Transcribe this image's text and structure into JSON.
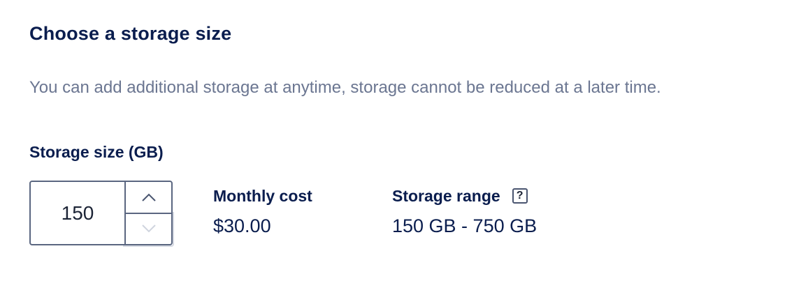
{
  "section": {
    "title": "Choose a storage size",
    "description": "You can add additional storage at anytime, storage cannot be reduced at a later time."
  },
  "storage_field": {
    "label": "Storage size (GB)",
    "value": "150",
    "increment_icon": "chevron-up-icon",
    "decrement_icon": "chevron-down-icon"
  },
  "monthly_cost": {
    "label": "Monthly cost",
    "value": "$30.00"
  },
  "storage_range": {
    "label": "Storage range",
    "help_icon": "help-icon",
    "help_glyph": "?",
    "value": "150 GB - 750 GB"
  },
  "colors": {
    "text_primary": "#0a1d4e",
    "text_secondary": "#6b7691",
    "border": "#5a6680",
    "border_disabled": "#d5d9e2"
  }
}
